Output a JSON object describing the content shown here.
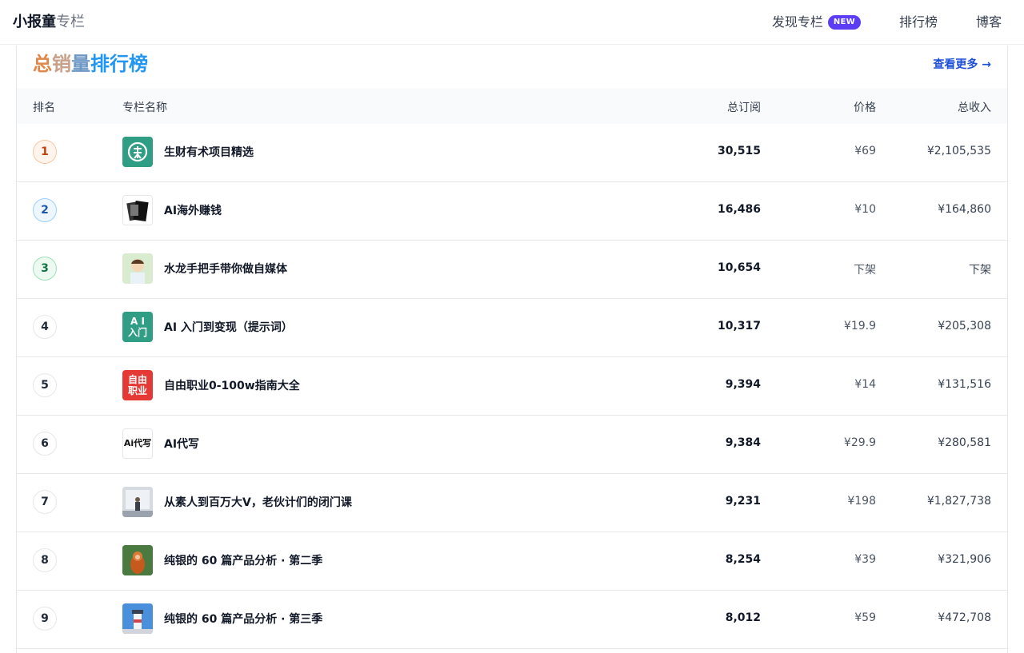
{
  "header": {
    "brand_bold": "小报童",
    "brand_light": "专栏",
    "nav": [
      {
        "label": "发现专栏",
        "badge": "NEW"
      },
      {
        "label": "排行榜"
      },
      {
        "label": "博客"
      }
    ]
  },
  "ranking": {
    "title_parts": [
      "总",
      "销",
      "量",
      "排行榜"
    ],
    "more_label": "查看更多 →",
    "columns": {
      "rank": "排名",
      "name": "专栏名称",
      "subs": "总订阅",
      "price": "价格",
      "income": "总收入"
    },
    "rows": [
      {
        "rank": "1",
        "name": "生财有术项目精选",
        "subs": "30,515",
        "price": "¥69",
        "income": "¥2,105,535",
        "thumb": "shengcai-logo-icon",
        "thumb_color": "#2f9e84"
      },
      {
        "rank": "2",
        "name": "AI海外赚钱",
        "subs": "16,486",
        "price": "¥10",
        "income": "¥164,860",
        "thumb": "money-stack-image",
        "thumb_color": "#ffffff"
      },
      {
        "rank": "3",
        "name": "水龙手把手带你做自媒体",
        "subs": "10,654",
        "price": "下架",
        "income": "下架",
        "thumb": "cartoon-avatar-image",
        "thumb_color": "#cfe8c4"
      },
      {
        "rank": "4",
        "name": "AI 入门到变现（提示词）",
        "subs": "10,317",
        "price": "¥19.9",
        "income": "¥205,308",
        "thumb": "ai-intro-cover",
        "thumb_color": "#2f9e84",
        "thumb_text": "A I\n入门"
      },
      {
        "rank": "5",
        "name": "自由职业0-100w指南大全",
        "subs": "9,394",
        "price": "¥14",
        "income": "¥131,516",
        "thumb": "freelance-cover",
        "thumb_color": "#e53935",
        "thumb_text": "自由\n职业"
      },
      {
        "rank": "6",
        "name": "AI代写",
        "subs": "9,384",
        "price": "¥29.9",
        "income": "¥280,581",
        "thumb": "ai-writing-logo",
        "thumb_color": "#ffffff",
        "thumb_text": "Ai代写"
      },
      {
        "rank": "7",
        "name": "从素人到百万大V，老伙计们的闭门课",
        "subs": "9,231",
        "price": "¥198",
        "income": "¥1,827,738",
        "thumb": "speaker-photo-image",
        "thumb_color": "#c9ced6"
      },
      {
        "rank": "8",
        "name": "纯银的 60 篇产品分析 · 第二季",
        "subs": "8,254",
        "price": "¥39",
        "income": "¥321,906",
        "thumb": "monkey-photo-image",
        "thumb_color": "#3f6b3a"
      },
      {
        "rank": "9",
        "name": "纯银的 60 篇产品分析 · 第三季",
        "subs": "8,012",
        "price": "¥59",
        "income": "¥472,708",
        "thumb": "lighthouse-photo-image",
        "thumb_color": "#3b7fd1"
      }
    ]
  }
}
